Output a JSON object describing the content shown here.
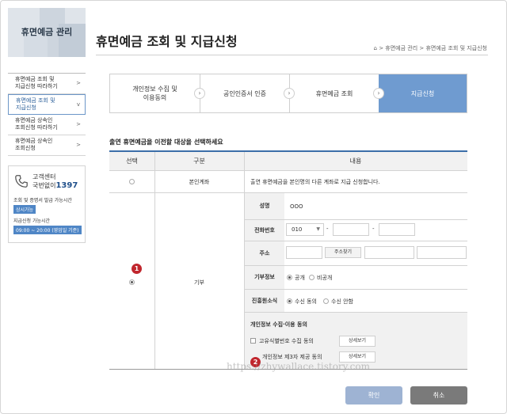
{
  "sidebar": {
    "title": "휴면예금 관리",
    "items": [
      {
        "line1": "휴면예금 조회 및",
        "line2": "지급신청 따라하기"
      },
      {
        "line1": "휴면예금 조회 및",
        "line2": "지급신청"
      },
      {
        "line1": "휴면예금 상속인",
        "line2": "조회신청 따라하기"
      },
      {
        "line1": "휴면예금 상속인",
        "line2": "조회신청"
      }
    ],
    "chevron": ">",
    "active_chevron": "v",
    "customer_center": {
      "label": "고객센터",
      "number_prefix": "국번없이",
      "number": "1397",
      "hours_label_1": "조회 및 증명서 발급 가능시간",
      "hours_value_1": "상시가능",
      "hours_label_2": "지급신청 가능시간",
      "hours_value_2": "09:00 ~ 20:00 (영업일 기준)"
    }
  },
  "header": {
    "title": "휴면예금 조회 및 지급신청",
    "breadcrumb": "> 휴면예금 관리 > 휴면예금 조회 및 지급신청"
  },
  "steps": [
    {
      "line1": "개인정보 수집 및",
      "line2": "이용동의"
    },
    {
      "line1": "공인인증서 인증",
      "line2": ""
    },
    {
      "line1": "휴면예금 조회",
      "line2": ""
    },
    {
      "line1": "지급신청",
      "line2": ""
    }
  ],
  "section_title": "출연 휴면예금을 이전할 대상을 선택하세요",
  "table": {
    "headers": [
      "선택",
      "구분",
      "내용"
    ],
    "row1": {
      "type": "본인계좌",
      "content": "출연 휴면예금을 본인명의 다른 계좌로 지급 신청합니다."
    },
    "row2": {
      "type": "기부",
      "name_label": "성명",
      "name_value": "OOO",
      "phone_label": "전화번호",
      "phone_prefix": "010",
      "dash": "-",
      "address_label": "주소",
      "address_button": "주소찾기",
      "donation_info_label": "기부정보",
      "donation_public": "공개",
      "donation_private": "비공개",
      "promo_label": "진흥원소식",
      "promo_agree": "수신 동의",
      "promo_disagree": "수신 안함",
      "consent_title": "개인정보 수집·이용 동의",
      "consent_1": "고유식별번호 수집 동의",
      "consent_2": "개인정보 제3자 제공 동의",
      "detail_button": "상세보기"
    }
  },
  "badges": [
    "1",
    "2"
  ],
  "watermark": "https://zhywallace.tistory.com",
  "buttons": {
    "confirm": "확인",
    "cancel": "취소"
  }
}
